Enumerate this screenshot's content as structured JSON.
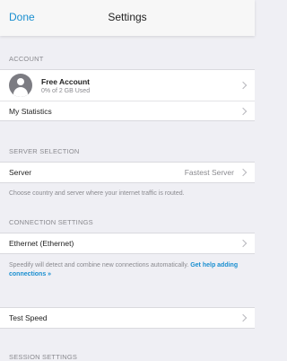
{
  "nav": {
    "done_label": "Done",
    "title": "Settings"
  },
  "account": {
    "header": "ACCOUNT",
    "name": "Free Account",
    "usage": "0% of 2 GB Used",
    "statistics_label": "My Statistics"
  },
  "server": {
    "header": "SERVER SELECTION",
    "label": "Server",
    "value": "Fastest Server",
    "footnote": "Choose country and server where your internet traffic is routed."
  },
  "connection": {
    "header": "CONNECTION SETTINGS",
    "label": "Ethernet (Ethernet)",
    "footnote": "Speedify will detect and combine new connections automatically.",
    "help_link": "Get help adding connections »"
  },
  "test_speed": {
    "label": "Test Speed"
  },
  "session": {
    "header": "SESSION SETTINGS"
  },
  "colors": {
    "accent": "#1a8fd0",
    "background": "#efeff4"
  },
  "icons": {
    "avatar": "user-avatar-icon",
    "disclosure": "chevron-right-icon"
  }
}
